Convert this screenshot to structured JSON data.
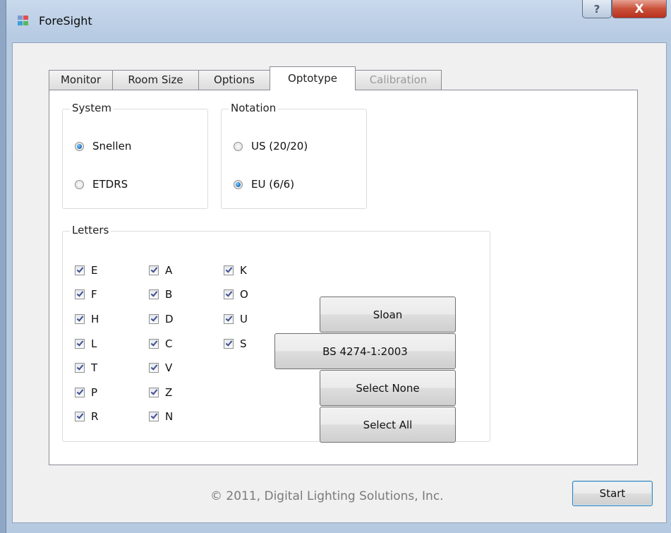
{
  "window": {
    "title": "ForeSight",
    "help_symbol": "?",
    "close_symbol": "X"
  },
  "tabs": [
    {
      "label": "Monitor",
      "state": "normal"
    },
    {
      "label": "Room Size",
      "state": "normal"
    },
    {
      "label": "Options",
      "state": "normal"
    },
    {
      "label": "Optotype",
      "state": "active"
    },
    {
      "label": "Calibration",
      "state": "disabled"
    }
  ],
  "system": {
    "label": "System",
    "options": [
      {
        "label": "Snellen",
        "checked": true
      },
      {
        "label": "ETDRS",
        "checked": false
      }
    ]
  },
  "notation": {
    "label": "Notation",
    "options": [
      {
        "label": "US (20/20)",
        "checked": false
      },
      {
        "label": "EU (6/6)",
        "checked": true
      }
    ]
  },
  "letters": {
    "label": "Letters",
    "col1": [
      "E",
      "F",
      "H",
      "L",
      "T",
      "P",
      "R"
    ],
    "col2": [
      "A",
      "B",
      "D",
      "C",
      "V",
      "Z",
      "N"
    ],
    "col3": [
      "K",
      "O",
      "U",
      "S"
    ],
    "checked": true
  },
  "buttons": {
    "sloan": "Sloan",
    "bs": "BS 4274-1:2003",
    "select_none": "Select None",
    "select_all": "Select All",
    "start": "Start"
  },
  "footer": {
    "copyright": "© 2011, Digital Lighting Solutions, Inc."
  },
  "colors": {
    "accent_radio": "#1f6bb8",
    "close_red": "#c9503a",
    "titlebar": "#c9d9ec"
  }
}
